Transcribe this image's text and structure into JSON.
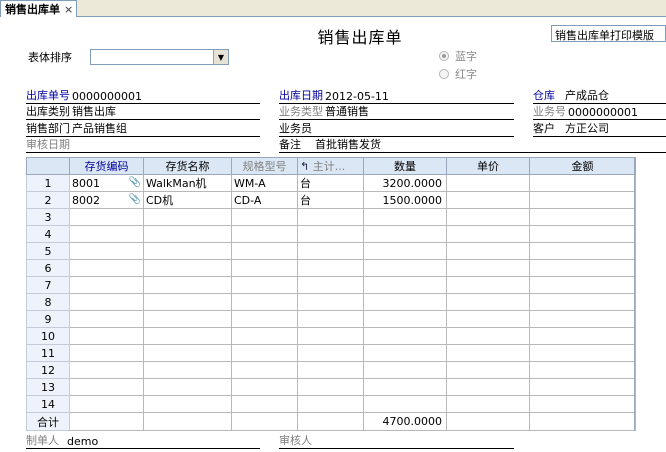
{
  "tab": {
    "label": "销售出库单",
    "close": "×"
  },
  "title": "销售出库单",
  "template": "销售出库单打印模版",
  "sort": {
    "label": "表体排序",
    "value": ""
  },
  "radio": {
    "blue": "蓝字",
    "red": "红字"
  },
  "header": {
    "doc_no": {
      "label": "出库单号",
      "value": "0000000001"
    },
    "doc_date": {
      "label": "出库日期",
      "value": "2012-05-11"
    },
    "warehouse": {
      "label": "仓库",
      "value": "产成品仓"
    },
    "out_type": {
      "label": "出库类别",
      "value": "销售出库"
    },
    "biz_type": {
      "label": "业务类型",
      "value": "普通销售"
    },
    "biz_no": {
      "label": "业务号",
      "value": "0000000001"
    },
    "dept": {
      "label": "销售部门",
      "value": "产品销售组"
    },
    "clerk": {
      "label": "业务员",
      "value": ""
    },
    "customer": {
      "label": "客户",
      "value": "方正公司"
    },
    "audit_date": {
      "label": "审核日期",
      "value": ""
    },
    "remark": {
      "label": "备注",
      "value": "首批销售发货"
    }
  },
  "columns": {
    "code": "存货编码",
    "name": "存货名称",
    "spec": "规格型号",
    "unit": "主计...",
    "qty": "数量",
    "price": "单价",
    "amount": "金额"
  },
  "rows": [
    {
      "no": "1",
      "code": "8001",
      "name": "WalkMan机",
      "spec": "WM-A",
      "unit": "台",
      "qty": "3200.0000",
      "price": "",
      "amount": ""
    },
    {
      "no": "2",
      "code": "8002",
      "name": "CD机",
      "spec": "CD-A",
      "unit": "台",
      "qty": "1500.0000",
      "price": "",
      "amount": ""
    },
    {
      "no": "3"
    },
    {
      "no": "4"
    },
    {
      "no": "5"
    },
    {
      "no": "6"
    },
    {
      "no": "7"
    },
    {
      "no": "8"
    },
    {
      "no": "9"
    },
    {
      "no": "10"
    },
    {
      "no": "11"
    },
    {
      "no": "12"
    },
    {
      "no": "13"
    },
    {
      "no": "14"
    }
  ],
  "total": {
    "label": "合计",
    "qty": "4700.0000"
  },
  "footer": {
    "maker": {
      "label": "制单人",
      "value": "demo"
    },
    "auditor": {
      "label": "审核人",
      "value": ""
    }
  }
}
